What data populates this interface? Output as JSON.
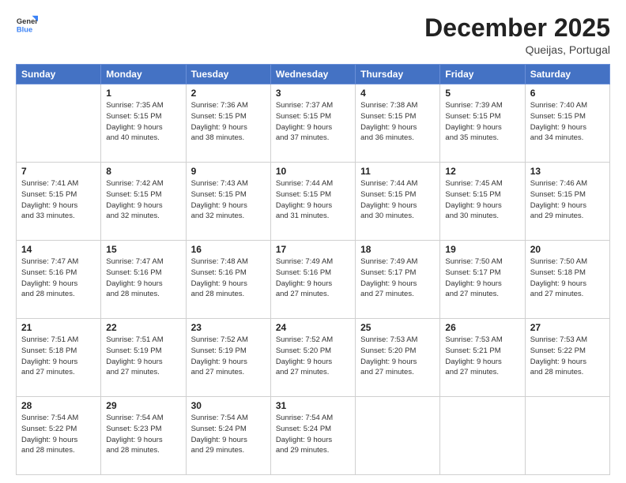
{
  "header": {
    "logo_general": "General",
    "logo_blue": "Blue",
    "month_year": "December 2025",
    "location": "Queijas, Portugal"
  },
  "weekdays": [
    "Sunday",
    "Monday",
    "Tuesday",
    "Wednesday",
    "Thursday",
    "Friday",
    "Saturday"
  ],
  "weeks": [
    [
      {
        "day": "",
        "info": ""
      },
      {
        "day": "1",
        "info": "Sunrise: 7:35 AM\nSunset: 5:15 PM\nDaylight: 9 hours\nand 40 minutes."
      },
      {
        "day": "2",
        "info": "Sunrise: 7:36 AM\nSunset: 5:15 PM\nDaylight: 9 hours\nand 38 minutes."
      },
      {
        "day": "3",
        "info": "Sunrise: 7:37 AM\nSunset: 5:15 PM\nDaylight: 9 hours\nand 37 minutes."
      },
      {
        "day": "4",
        "info": "Sunrise: 7:38 AM\nSunset: 5:15 PM\nDaylight: 9 hours\nand 36 minutes."
      },
      {
        "day": "5",
        "info": "Sunrise: 7:39 AM\nSunset: 5:15 PM\nDaylight: 9 hours\nand 35 minutes."
      },
      {
        "day": "6",
        "info": "Sunrise: 7:40 AM\nSunset: 5:15 PM\nDaylight: 9 hours\nand 34 minutes."
      }
    ],
    [
      {
        "day": "7",
        "info": "Sunrise: 7:41 AM\nSunset: 5:15 PM\nDaylight: 9 hours\nand 33 minutes."
      },
      {
        "day": "8",
        "info": "Sunrise: 7:42 AM\nSunset: 5:15 PM\nDaylight: 9 hours\nand 32 minutes."
      },
      {
        "day": "9",
        "info": "Sunrise: 7:43 AM\nSunset: 5:15 PM\nDaylight: 9 hours\nand 32 minutes."
      },
      {
        "day": "10",
        "info": "Sunrise: 7:44 AM\nSunset: 5:15 PM\nDaylight: 9 hours\nand 31 minutes."
      },
      {
        "day": "11",
        "info": "Sunrise: 7:44 AM\nSunset: 5:15 PM\nDaylight: 9 hours\nand 30 minutes."
      },
      {
        "day": "12",
        "info": "Sunrise: 7:45 AM\nSunset: 5:15 PM\nDaylight: 9 hours\nand 30 minutes."
      },
      {
        "day": "13",
        "info": "Sunrise: 7:46 AM\nSunset: 5:15 PM\nDaylight: 9 hours\nand 29 minutes."
      }
    ],
    [
      {
        "day": "14",
        "info": "Sunrise: 7:47 AM\nSunset: 5:16 PM\nDaylight: 9 hours\nand 28 minutes."
      },
      {
        "day": "15",
        "info": "Sunrise: 7:47 AM\nSunset: 5:16 PM\nDaylight: 9 hours\nand 28 minutes."
      },
      {
        "day": "16",
        "info": "Sunrise: 7:48 AM\nSunset: 5:16 PM\nDaylight: 9 hours\nand 28 minutes."
      },
      {
        "day": "17",
        "info": "Sunrise: 7:49 AM\nSunset: 5:16 PM\nDaylight: 9 hours\nand 27 minutes."
      },
      {
        "day": "18",
        "info": "Sunrise: 7:49 AM\nSunset: 5:17 PM\nDaylight: 9 hours\nand 27 minutes."
      },
      {
        "day": "19",
        "info": "Sunrise: 7:50 AM\nSunset: 5:17 PM\nDaylight: 9 hours\nand 27 minutes."
      },
      {
        "day": "20",
        "info": "Sunrise: 7:50 AM\nSunset: 5:18 PM\nDaylight: 9 hours\nand 27 minutes."
      }
    ],
    [
      {
        "day": "21",
        "info": "Sunrise: 7:51 AM\nSunset: 5:18 PM\nDaylight: 9 hours\nand 27 minutes."
      },
      {
        "day": "22",
        "info": "Sunrise: 7:51 AM\nSunset: 5:19 PM\nDaylight: 9 hours\nand 27 minutes."
      },
      {
        "day": "23",
        "info": "Sunrise: 7:52 AM\nSunset: 5:19 PM\nDaylight: 9 hours\nand 27 minutes."
      },
      {
        "day": "24",
        "info": "Sunrise: 7:52 AM\nSunset: 5:20 PM\nDaylight: 9 hours\nand 27 minutes."
      },
      {
        "day": "25",
        "info": "Sunrise: 7:53 AM\nSunset: 5:20 PM\nDaylight: 9 hours\nand 27 minutes."
      },
      {
        "day": "26",
        "info": "Sunrise: 7:53 AM\nSunset: 5:21 PM\nDaylight: 9 hours\nand 27 minutes."
      },
      {
        "day": "27",
        "info": "Sunrise: 7:53 AM\nSunset: 5:22 PM\nDaylight: 9 hours\nand 28 minutes."
      }
    ],
    [
      {
        "day": "28",
        "info": "Sunrise: 7:54 AM\nSunset: 5:22 PM\nDaylight: 9 hours\nand 28 minutes."
      },
      {
        "day": "29",
        "info": "Sunrise: 7:54 AM\nSunset: 5:23 PM\nDaylight: 9 hours\nand 28 minutes."
      },
      {
        "day": "30",
        "info": "Sunrise: 7:54 AM\nSunset: 5:24 PM\nDaylight: 9 hours\nand 29 minutes."
      },
      {
        "day": "31",
        "info": "Sunrise: 7:54 AM\nSunset: 5:24 PM\nDaylight: 9 hours\nand 29 minutes."
      },
      {
        "day": "",
        "info": ""
      },
      {
        "day": "",
        "info": ""
      },
      {
        "day": "",
        "info": ""
      }
    ]
  ]
}
